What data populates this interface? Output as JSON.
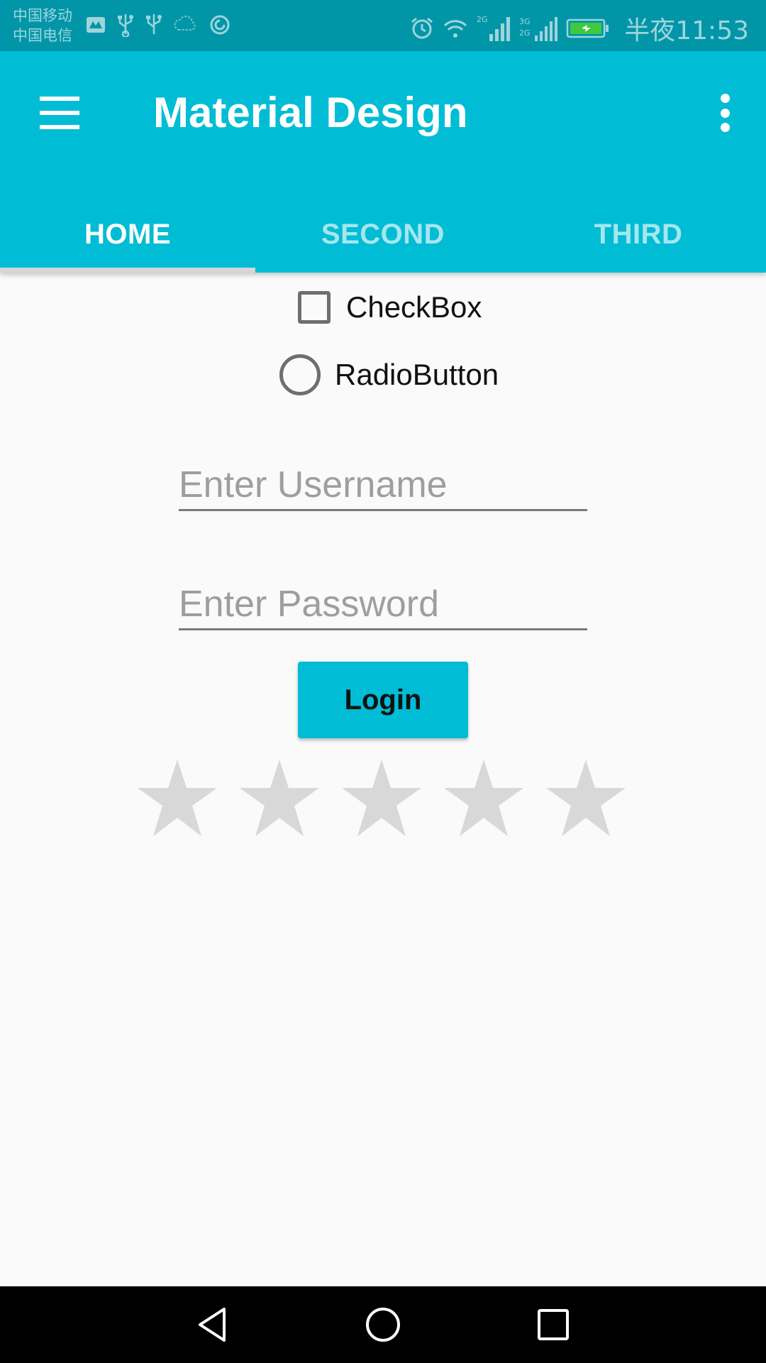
{
  "status_bar": {
    "carrier_1": "中国移动",
    "carrier_2": "中国电信",
    "time": "半夜11:53",
    "left_icons": [
      "notification-icon",
      "usb-icon",
      "usb-icon",
      "weather-icon",
      "sync-icon"
    ],
    "right_icons": [
      "alarm-icon",
      "wifi-icon",
      "signal-2g-icon",
      "signal-3g-icon",
      "battery-charging-icon"
    ],
    "signal_labels": [
      "2G",
      "3G",
      "2G"
    ]
  },
  "app_bar": {
    "title": "Material Design",
    "menu_icon": "hamburger-icon",
    "overflow_icon": "more-vert-icon",
    "color": "#00bcd4"
  },
  "tabs": [
    {
      "label": "HOME",
      "selected": true
    },
    {
      "label": "SECOND",
      "selected": false
    },
    {
      "label": "THIRD",
      "selected": false
    }
  ],
  "form": {
    "checkbox_label": "CheckBox",
    "checkbox_checked": false,
    "radio_label": "RadioButton",
    "radio_checked": false,
    "username_placeholder": "Enter Username",
    "username_value": "",
    "password_placeholder": "Enter Password",
    "password_value": "",
    "login_label": "Login"
  },
  "rating": {
    "max": 5,
    "value": 0,
    "star_color": "#d8d8d8"
  },
  "nav_bar": {
    "buttons": [
      "back-icon",
      "home-icon",
      "recents-icon"
    ]
  }
}
